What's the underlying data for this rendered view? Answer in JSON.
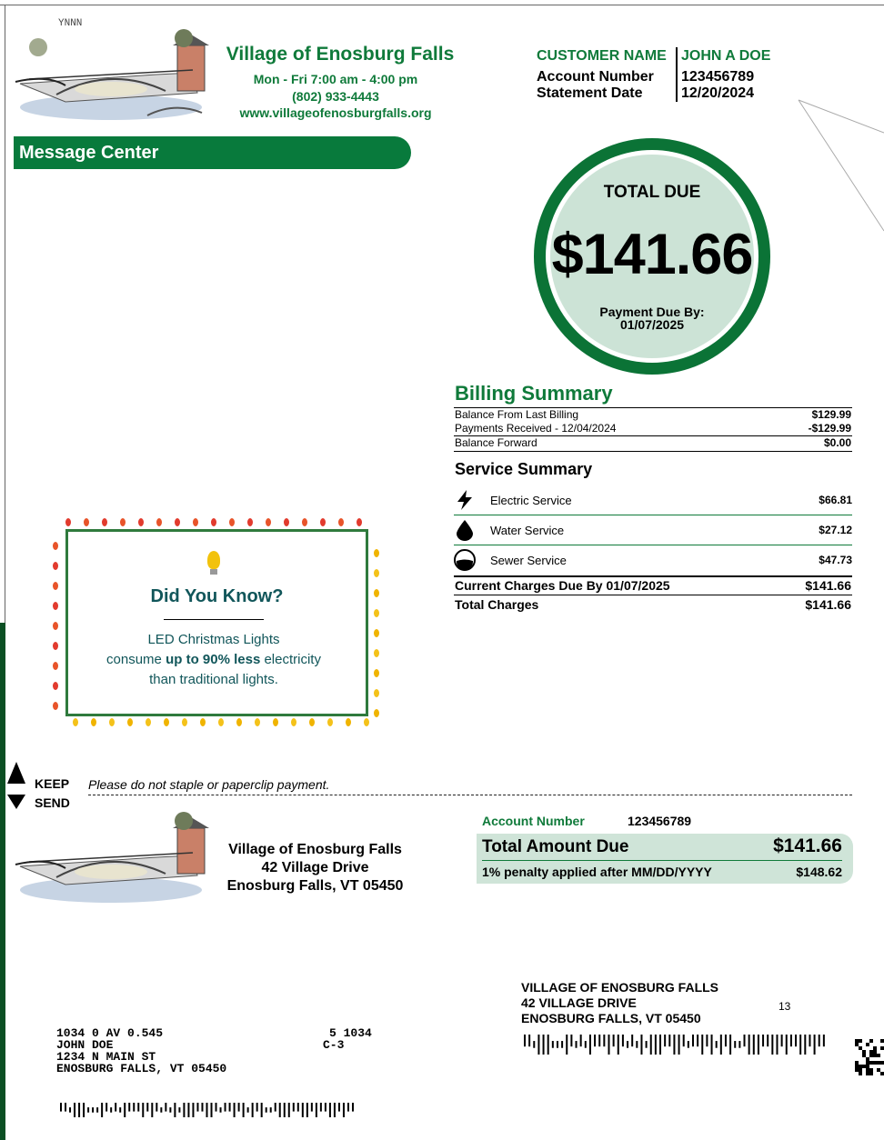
{
  "header": {
    "code": "YNNN",
    "village_name": "Village of Enosburg Falls",
    "hours": "Mon - Fri 7:00 am - 4:00 pm",
    "phone": "(802) 933-4443",
    "website": "www.villageofenosburgfalls.org"
  },
  "customer": {
    "name_label": "CUSTOMER NAME",
    "name": "JOHN A DOE",
    "account_label": "Account Number",
    "account": "123456789",
    "statement_label": "Statement Date",
    "statement_date": "12/20/2024"
  },
  "message_center": {
    "label": "Message Center"
  },
  "total_due": {
    "label": "TOTAL DUE",
    "amount": "$141.66",
    "due_label": "Payment Due By:",
    "due_date": "01/07/2025"
  },
  "billing_summary": {
    "title": "Billing Summary",
    "rows": [
      {
        "label": "Balance From Last Billing",
        "value": "$129.99"
      },
      {
        "label": "Payments Received - 12/04/2024",
        "value": "-$129.99"
      },
      {
        "label": "Balance Forward",
        "value": "$0.00"
      }
    ]
  },
  "service_summary": {
    "title": "Service Summary",
    "services": [
      {
        "icon": "lightning-icon",
        "label": "Electric Service",
        "value": "$66.81"
      },
      {
        "icon": "water-drop-icon",
        "label": "Water Service",
        "value": "$27.12"
      },
      {
        "icon": "sewer-icon",
        "label": "Sewer Service",
        "value": "$47.73"
      }
    ],
    "current_label": "Current Charges Due By 01/07/2025",
    "current_value": "$141.66",
    "total_label": "Total Charges",
    "total_value": "$141.66"
  },
  "did_you_know": {
    "title": "Did You Know?",
    "line1": "LED Christmas Lights",
    "line2_pre": "consume ",
    "line2_bold": "up to 90% less",
    "line2_post": " electricity",
    "line3": "than traditional lights."
  },
  "cut": {
    "keep": "KEEP",
    "send": "SEND",
    "note": "Please do not staple or paperclip payment."
  },
  "remit": {
    "name": "Village of Enosburg Falls",
    "street": "42 Village Drive",
    "city": "Enosburg Falls, VT 05450"
  },
  "stub": {
    "account_label": "Account Number",
    "account": "123456789",
    "total_label": "Total Amount Due",
    "total_value": "$141.66",
    "penalty_label": "1% penalty applied after MM/DD/YYYY",
    "penalty_value": "$148.62"
  },
  "mail_to": {
    "line1": "VILLAGE OF ENOSBURG FALLS",
    "line2": "42 VILLAGE DRIVE",
    "line3": "ENOSBURG FALLS, VT 05450",
    "number": "13"
  },
  "customer_address": {
    "code_line": "1034 0 AV 0.545",
    "code_right1": "5 1034",
    "code_right2": "C-3",
    "name": "JOHN DOE",
    "street": "1234 N MAIN ST",
    "city": "ENOSBURG FALLS, VT 05450"
  },
  "colors": {
    "brand_green": "#0f7a3a",
    "circle_fill": "#cce3d6",
    "card_text": "#11565a"
  }
}
